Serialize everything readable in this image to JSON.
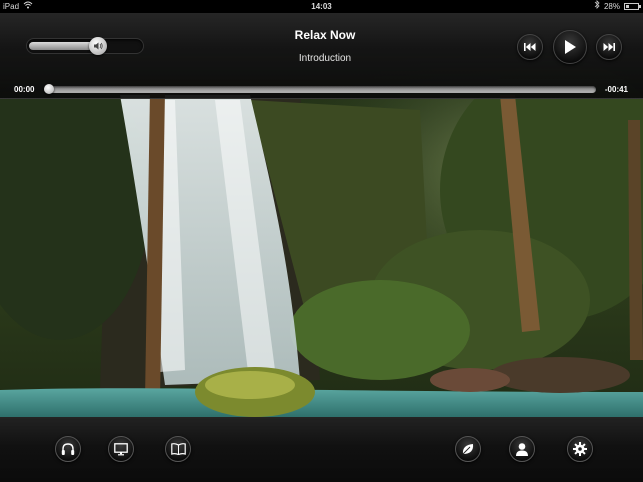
{
  "status_bar": {
    "device": "iPad",
    "time": "14:03",
    "battery": "28%",
    "battery_level": 0.28
  },
  "player": {
    "title": "Relax Now",
    "subtitle": "Introduction",
    "elapsed": "00:00",
    "remaining": "-00:41",
    "progress": 0.0,
    "volume": 0.65
  },
  "icons": {
    "wifi": "wifi-icon",
    "bluetooth": "bluetooth-icon",
    "speaker": "speaker-icon",
    "previous": "skip-back-icon",
    "play": "play-icon",
    "next": "skip-forward-icon",
    "headphones": "headphones-icon",
    "screen": "monitor-icon",
    "book": "book-icon",
    "leaf": "leaf-icon",
    "user": "user-icon",
    "settings": "gear-icon"
  },
  "colors": {
    "bar_dark": "#111111",
    "accent_white": "#ffffff"
  }
}
